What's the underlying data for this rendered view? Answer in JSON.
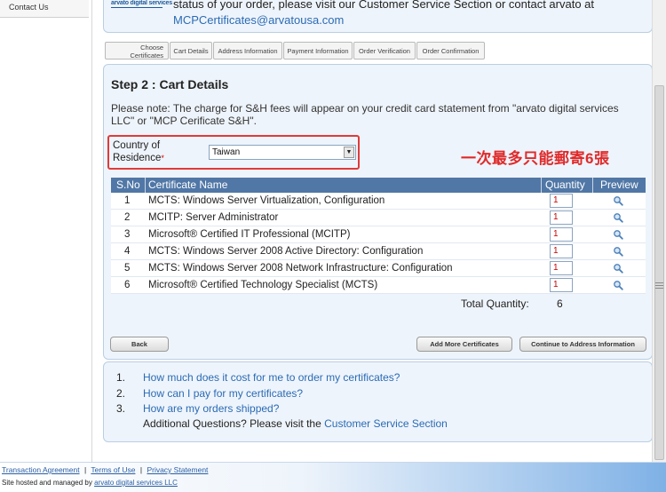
{
  "sidebar": {
    "items": [
      {
        "label": "Contact Us"
      }
    ]
  },
  "top_info": {
    "logo_text": "arvato digital services",
    "line1": "status of your order, please visit our Customer Service Section or contact arvato at",
    "email": "MCPCertificates@arvatousa.com"
  },
  "steps": [
    {
      "label_line1": "Choose",
      "label_line2": "Certificates"
    },
    {
      "label_line1": "Cart Details",
      "label_line2": ""
    },
    {
      "label_line1": "Address Information",
      "label_line2": ""
    },
    {
      "label_line1": "Payment Information",
      "label_line2": ""
    },
    {
      "label_line1": "Order Verification",
      "label_line2": ""
    },
    {
      "label_line1": "Order Confirmation",
      "label_line2": ""
    }
  ],
  "main": {
    "heading": "Step 2 : Cart Details",
    "note": "Please note: The charge for S&H fees will appear on your credit card statement from \"arvato digital services LLC\" or \"MCP Cerificate S&H\".",
    "country_label_line1": "Country of",
    "country_label_line2": "Residence",
    "country_required": "*",
    "country_value": "Taiwan",
    "annotation": "一次最多只能郵寄6張"
  },
  "table": {
    "headers": {
      "sno": "S.No",
      "name": "Certificate Name",
      "qty": "Quantity",
      "preview": "Preview"
    },
    "rows": [
      {
        "sno": "1",
        "name": "MCTS: Windows Server Virtualization, Configuration",
        "qty": "1"
      },
      {
        "sno": "2",
        "name": "MCITP: Server Administrator",
        "qty": "1"
      },
      {
        "sno": "3",
        "name": "Microsoft® Certified IT Professional (MCITP)",
        "qty": "1"
      },
      {
        "sno": "4",
        "name": "MCTS: Windows Server 2008 Active Directory: Configuration",
        "qty": "1"
      },
      {
        "sno": "5",
        "name": "MCTS: Windows Server 2008 Network Infrastructure: Configuration",
        "qty": "1"
      },
      {
        "sno": "6",
        "name": "Microsoft® Certified Technology Specialist (MCTS)",
        "qty": "1"
      }
    ],
    "total_label": "Total Quantity:",
    "total_value": "6"
  },
  "buttons": {
    "back": "Back",
    "add_more": "Add More Certificates",
    "continue": "Continue to Address Information"
  },
  "faq": {
    "items": [
      {
        "num": "1.",
        "text": "How much does it cost for me to order my certificates?"
      },
      {
        "num": "2.",
        "text": "How can I pay for my certificates?"
      },
      {
        "num": "3.",
        "text": "How are my orders shipped?"
      }
    ],
    "extra_prefix": "Additional Questions? Please visit the ",
    "extra_link": "Customer Service Section"
  },
  "footer": {
    "link1": "Transaction Agreement",
    "sep": "|",
    "link2": "Terms of Use",
    "link3": "Privacy Statement",
    "hosted_prefix": "Site hosted and managed by ",
    "hosted_link": "arvato digital services LLC"
  },
  "colors": {
    "accent": "#2a6bb5",
    "header_blue": "#5077a6",
    "annotation_red": "#e02a2a",
    "panel_bg": "#eef4fb"
  }
}
